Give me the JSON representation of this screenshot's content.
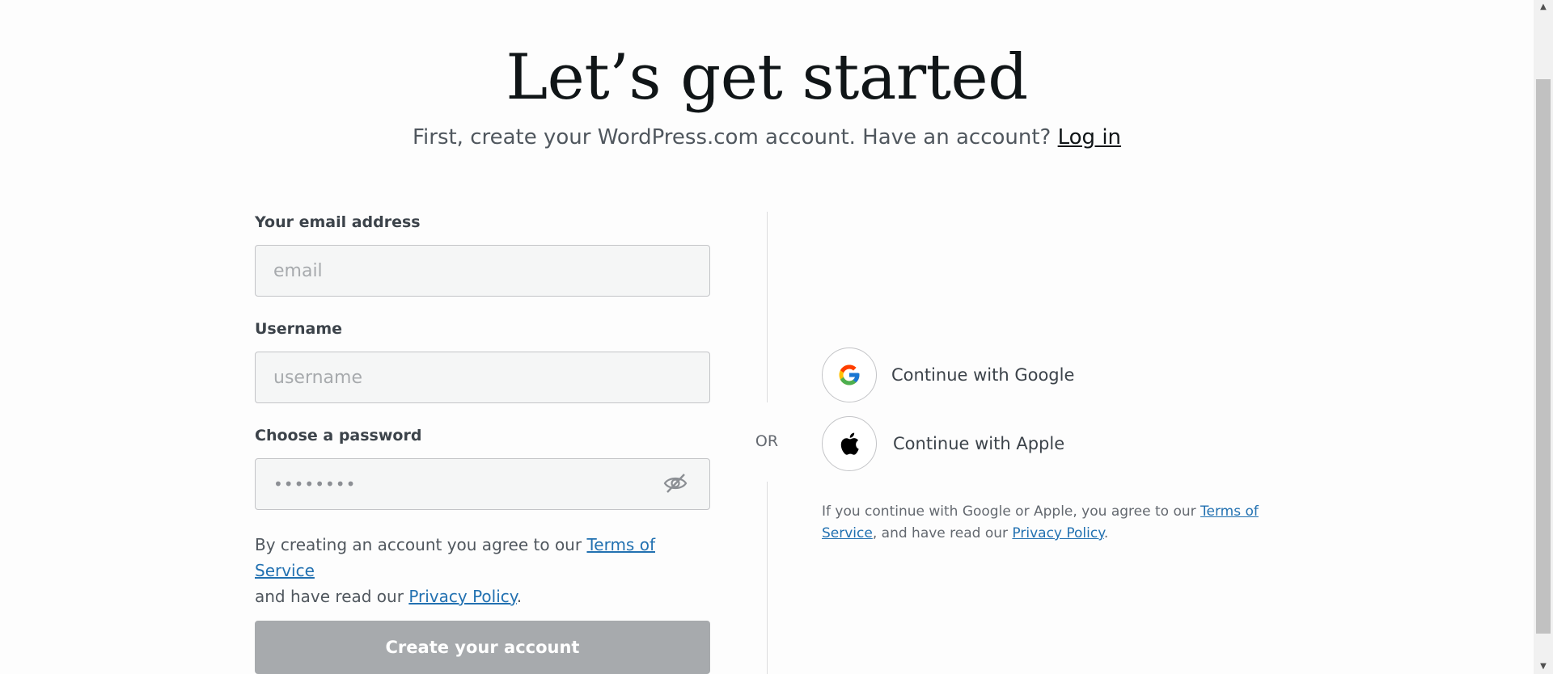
{
  "header": {
    "title": "Let’s get started",
    "subtitle": "First, create your WordPress.com account. Have an account?",
    "login_link": "Log in"
  },
  "form": {
    "email": {
      "label": "Your email address",
      "placeholder": "email",
      "value": ""
    },
    "username": {
      "label": "Username",
      "placeholder": "username",
      "value": ""
    },
    "password": {
      "label": "Choose a password",
      "masked_value": "••••••••",
      "toggle_icon": "eye-slash-icon"
    },
    "legal": {
      "prefix": "By creating an account you agree to our",
      "terms_link": "Terms of Service",
      "middle": "and have read our",
      "privacy_link": "Privacy Policy",
      "suffix": "."
    },
    "submit_label": "Create your account"
  },
  "divider": {
    "label": "OR"
  },
  "social": {
    "google": {
      "label": "Continue with Google",
      "icon": "google-icon"
    },
    "apple": {
      "label": "Continue with Apple",
      "icon": "apple-icon"
    },
    "legal": {
      "prefix": "If you continue with Google or Apple, you agree to our",
      "terms_link": "Terms of Service",
      "middle": ", and have read our",
      "privacy_link": "Privacy Policy",
      "suffix": "."
    }
  },
  "colors": {
    "link": "#2271b1",
    "button_disabled": "#a7aaad",
    "field_bg": "#f5f6f6"
  }
}
